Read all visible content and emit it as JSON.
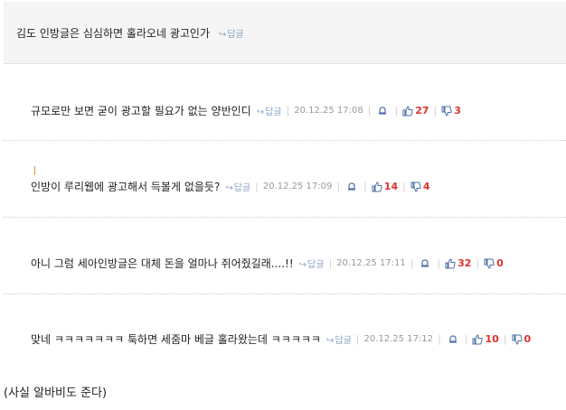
{
  "top_comment": {
    "text": "김도 인방글은 심심하면 홀라오네 광고인가",
    "reply_label": "답글"
  },
  "replies": [
    {
      "text": "규모로만 보면 굳이 광고할 필요가 없는 양반인디",
      "reply_label": "답글",
      "date": "20.12.25 17:08",
      "up": "27",
      "down": "3"
    },
    {
      "text": "인방이 루리웹에 광고해서 득볼게 없을듯?",
      "reply_label": "답글",
      "date": "20.12.25 17:09",
      "up": "14",
      "down": "4"
    },
    {
      "text": "아니 그럼 세아인방글은 대체 돈을 얼마나 쥐어줬길래....!!",
      "reply_label": "답글",
      "date": "20.12.25 17:11",
      "up": "32",
      "down": "0"
    },
    {
      "text": "맞네 ㅋㅋㅋㅋㅋㅋㅋ 툭하면 세줌마 베글 홀라왔는데 ㅋㅋㅋㅋㅋ",
      "reply_label": "답글",
      "date": "20.12.25 17:12",
      "up": "10",
      "down": "0"
    }
  ],
  "footnote": "(사실 알바비도 준다)",
  "icons": {
    "reply": "reply-arrow-icon",
    "bell": "bell-icon",
    "thumb_up": "thumb-up-icon",
    "thumb_down": "thumb-down-icon"
  },
  "colors": {
    "reply_link": "#8aa4c8",
    "count": "#e0322d",
    "date": "#9a9a9a"
  }
}
